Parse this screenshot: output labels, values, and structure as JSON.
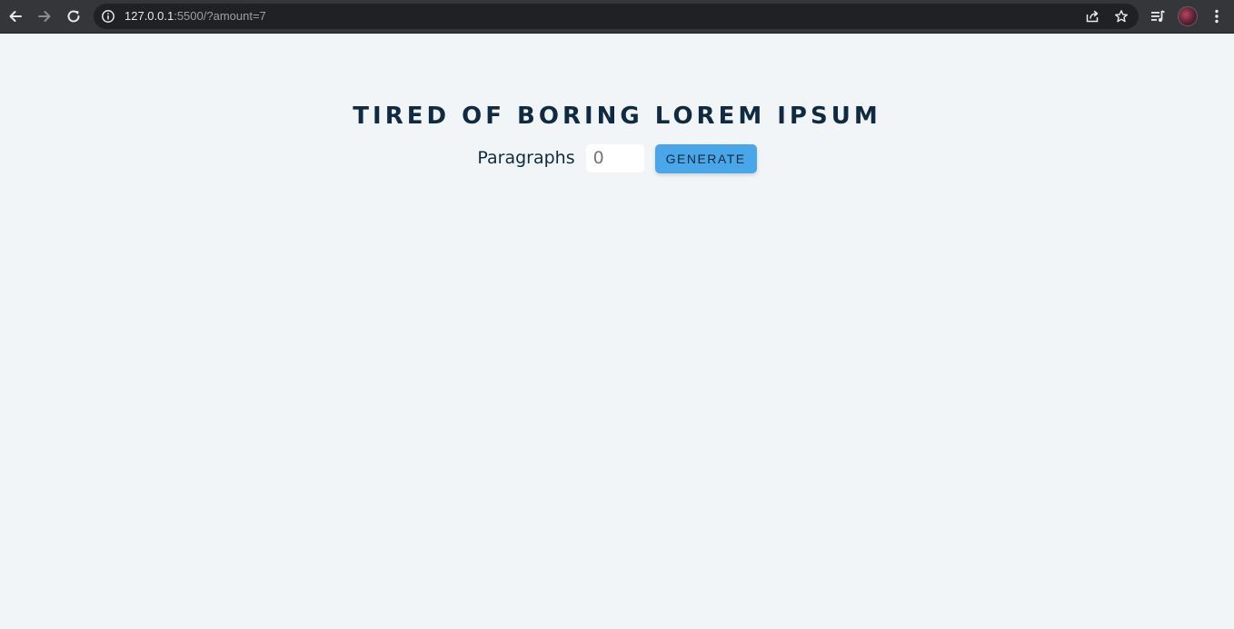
{
  "browser": {
    "url_host": "127.0.0.1",
    "url_rest": ":5500/?amount=7"
  },
  "page": {
    "title": "TIRED OF BORING LOREM IPSUM",
    "form": {
      "label": "Paragraphs",
      "amount_placeholder": "0",
      "button_label": "GENERATE"
    }
  },
  "colors": {
    "background": "#f1f5f8",
    "heading": "#102a42",
    "button": "#49a6e9"
  }
}
